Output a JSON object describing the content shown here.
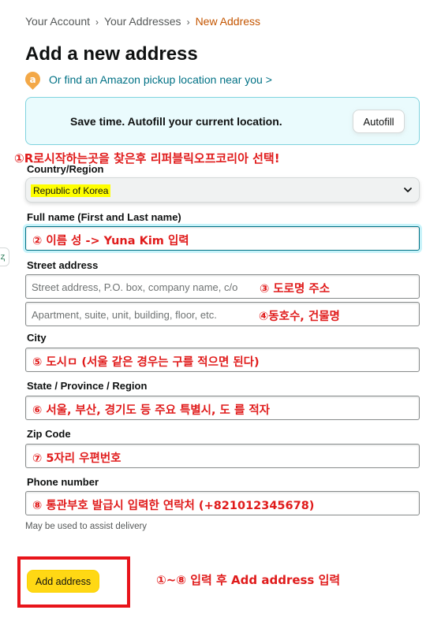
{
  "breadcrumb": {
    "items": [
      "Your Account",
      "Your Addresses",
      "New Address"
    ],
    "separator": "›"
  },
  "page": {
    "title": "Add a new address",
    "pickup_icon_letter": "a",
    "pickup_link": "Or find an Amazon pickup location near you >"
  },
  "autofill": {
    "text": "Save time. Autofill your current location.",
    "button_label": "Autofill"
  },
  "form": {
    "country_label": "Country/Region",
    "country_value": "Republic of Korea",
    "fullname_label": "Full name (First and Last name)",
    "street_label": "Street address",
    "street_placeholder": "Street address, P.O. box, company name, c/o",
    "street2_placeholder": "Apartment, suite, unit, building, floor, etc.",
    "city_label": "City",
    "state_label": "State / Province / Region",
    "zip_label": "Zip Code",
    "phone_label": "Phone number",
    "phone_helper": "May be used to assist delivery",
    "submit_label": "Add address"
  },
  "annotations": {
    "country": "①R로시작하는곳을 찾은후 리퍼블릭오프코리아 선택!",
    "fullname": "② 이름 성 -> Yuna Kim 입력",
    "street": "③ 도로명 주소",
    "street2": "④동호수, 건물명",
    "city": "⑤ 도시ㅁ (서울 같은 경우는 구를 적으면 된다)",
    "state": "⑥ 서울, 부산, 경기도 등 주요 특별시, 도 를 적자",
    "zip": "⑦ 5자리 우편번호",
    "phone": "⑧ 통관부호 발급시 입력한 연락처 (+821012345678)",
    "submit": "①~⑧ 입력 후 Add address 입력"
  },
  "side_widget_glyph": "ⱬ",
  "colors": {
    "link": "#007185",
    "breadcrumb_current": "#c45500",
    "annotation_red": "#e01b1b",
    "button_yellow": "#ffd814",
    "autofill_bg": "#eafbfd",
    "highlight_yellow": "#ffff00"
  }
}
